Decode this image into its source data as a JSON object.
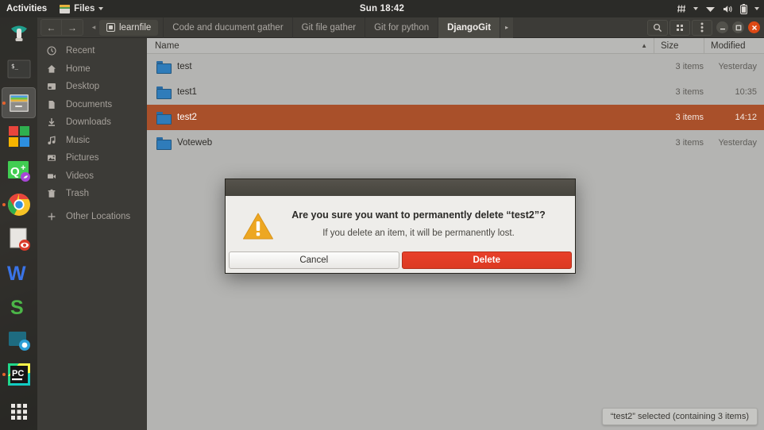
{
  "topbar": {
    "activities": "Activities",
    "app_menu": "Files",
    "clock": "Sun 18:42",
    "tray_icons": [
      "keyboard-indicator-icon",
      "wifi-icon",
      "volume-icon",
      "battery-icon",
      "system-menu-caret-icon"
    ]
  },
  "dock": {
    "items": [
      {
        "name": "ubuntu-software",
        "running": false
      },
      {
        "name": "terminal",
        "running": false
      },
      {
        "name": "files",
        "running": true
      },
      {
        "name": "microsoft-office",
        "running": false
      },
      {
        "name": "qt-creator",
        "running": false
      },
      {
        "name": "google-chrome",
        "running": true
      },
      {
        "name": "pdf-reader",
        "running": false
      },
      {
        "name": "wps-writer",
        "running": false
      },
      {
        "name": "wps-spreadsheet",
        "running": false
      },
      {
        "name": "screenshot-tool",
        "running": false
      },
      {
        "name": "pycharm",
        "running": true
      },
      {
        "name": "show-applications",
        "running": false
      }
    ]
  },
  "headerbar": {
    "back_label": "←",
    "forward_label": "→",
    "crumb_scroll_label": "◂",
    "breadcrumb": "learnfile",
    "tabs": [
      {
        "label": "Code and ducument gather",
        "active": false
      },
      {
        "label": "Git file gather",
        "active": false
      },
      {
        "label": "Git for python",
        "active": false
      },
      {
        "label": "DjangoGit",
        "active": true
      }
    ],
    "tab_overflow_label": "▸",
    "search_label": "⌕",
    "view_label": "∷",
    "menu_label": "⋮",
    "window_buttons": [
      "minimize",
      "maximize",
      "close"
    ]
  },
  "sidebar": {
    "items": [
      {
        "label": "Recent",
        "icon": "clock-icon"
      },
      {
        "label": "Home",
        "icon": "home-icon"
      },
      {
        "label": "Desktop",
        "icon": "desktop-icon"
      },
      {
        "label": "Documents",
        "icon": "document-icon"
      },
      {
        "label": "Downloads",
        "icon": "download-icon"
      },
      {
        "label": "Music",
        "icon": "music-note-icon"
      },
      {
        "label": "Pictures",
        "icon": "picture-icon"
      },
      {
        "label": "Videos",
        "icon": "video-camera-icon"
      },
      {
        "label": "Trash",
        "icon": "trash-icon"
      },
      {
        "label": "Other Locations",
        "icon": "plus-icon"
      }
    ]
  },
  "filelist": {
    "columns": {
      "name": "Name",
      "size": "Size",
      "modified": "Modified",
      "sort_indicator": "▲"
    },
    "rows": [
      {
        "name": "test",
        "size": "3 items",
        "modified": "Yesterday",
        "selected": false
      },
      {
        "name": "test1",
        "size": "3 items",
        "modified": "10:35",
        "selected": false
      },
      {
        "name": "test2",
        "size": "3 items",
        "modified": "14:12",
        "selected": true
      },
      {
        "name": "Voteweb",
        "size": "3 items",
        "modified": "Yesterday",
        "selected": false
      }
    ]
  },
  "statusbar": {
    "text": "“test2” selected  (containing 3 items)"
  },
  "dialog": {
    "title": "Are you sure you want to permanently delete “test2”?",
    "subtitle": "If you delete an item, it will be permanently lost.",
    "cancel_label": "Cancel",
    "delete_label": "Delete",
    "icon": "warning-triangle-icon"
  },
  "colors": {
    "selection": "#a9502a",
    "delete_button": "#e0412b",
    "close_button": "#dd4814",
    "warning": "#eda722",
    "folder": "#2f7cba"
  }
}
